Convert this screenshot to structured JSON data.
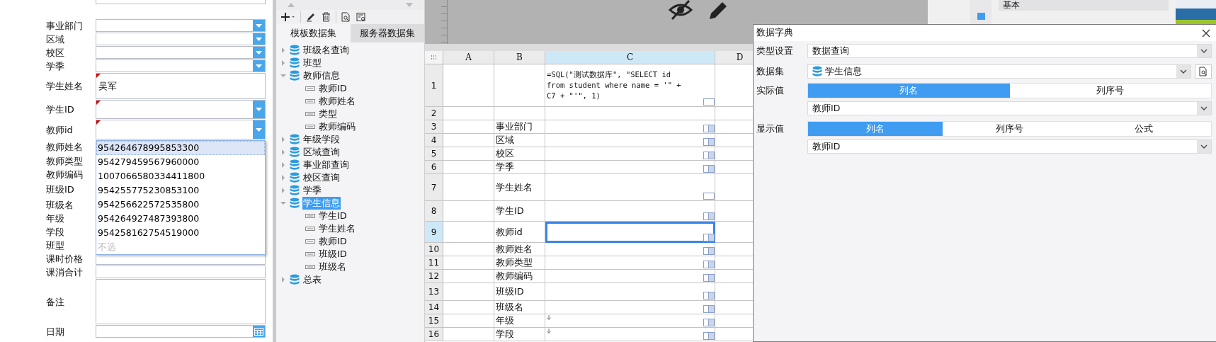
{
  "form": {
    "fields": [
      {
        "label": "事业部门",
        "kind": "combo",
        "flagged": false
      },
      {
        "label": "区域",
        "kind": "combo",
        "flagged": false
      },
      {
        "label": "校区",
        "kind": "combo",
        "flagged": false
      },
      {
        "label": "学季",
        "kind": "combo",
        "flagged": false
      },
      {
        "label": "学生姓名",
        "kind": "text",
        "value": "吴军",
        "flagged": true
      },
      {
        "label": "学生ID",
        "kind": "combo",
        "flagged": true
      },
      {
        "label": "教师id",
        "kind": "combo",
        "flagged": true
      },
      {
        "label": "教师姓名",
        "kind": "covered"
      },
      {
        "label": "教师类型",
        "kind": "covered"
      },
      {
        "label": "教师编码",
        "kind": "covered"
      },
      {
        "label": "班级ID",
        "kind": "covered"
      },
      {
        "label": "班级名",
        "kind": "covered"
      },
      {
        "label": "年级",
        "kind": "covered"
      },
      {
        "label": "学段",
        "kind": "covered"
      },
      {
        "label": "班型",
        "kind": "covered"
      },
      {
        "label": "课时价格",
        "kind": "text",
        "flagged": false
      },
      {
        "label": "课消合计",
        "kind": "text",
        "flagged": false
      },
      {
        "label": "备注",
        "kind": "textarea",
        "flagged": false
      },
      {
        "label": "日期",
        "kind": "date",
        "flagged": false
      }
    ],
    "dropdown": {
      "options": [
        {
          "text": "954264678995853300",
          "selected": true,
          "disabled": false
        },
        {
          "text": "954279459567960000",
          "selected": false,
          "disabled": false
        },
        {
          "text": "1007066580334411800",
          "selected": false,
          "disabled": false
        },
        {
          "text": "954255775230853100",
          "selected": false,
          "disabled": false
        },
        {
          "text": "954256622572535800",
          "selected": false,
          "disabled": false
        },
        {
          "text": "954264927487393800",
          "selected": false,
          "disabled": false
        },
        {
          "text": "954258162754519000",
          "selected": false,
          "disabled": false
        },
        {
          "text": "不选",
          "selected": false,
          "disabled": true
        }
      ]
    }
  },
  "dataset_panel": {
    "tabs": [
      {
        "label": "模板数据集",
        "selected": true
      },
      {
        "label": "服务器数据集",
        "selected": false
      }
    ],
    "tree": [
      {
        "label": "班级名查询",
        "kind": "dataset",
        "expanded": false,
        "selected": false
      },
      {
        "label": "班型",
        "kind": "dataset",
        "expanded": false,
        "selected": false
      },
      {
        "label": "教师信息",
        "kind": "dataset",
        "expanded": true,
        "selected": false,
        "children": [
          {
            "label": "教师ID",
            "kind": "field",
            "selected": false
          },
          {
            "label": "教师姓名",
            "kind": "field",
            "selected": false
          },
          {
            "label": "类型",
            "kind": "field",
            "selected": false
          },
          {
            "label": "教师编码",
            "kind": "field",
            "selected": false
          }
        ]
      },
      {
        "label": "年级学段",
        "kind": "dataset",
        "expanded": false,
        "selected": false
      },
      {
        "label": "区域查询",
        "kind": "dataset",
        "expanded": false,
        "selected": false
      },
      {
        "label": "事业部查询",
        "kind": "dataset",
        "expanded": false,
        "selected": false
      },
      {
        "label": "校区查询",
        "kind": "dataset",
        "expanded": false,
        "selected": false
      },
      {
        "label": "学季",
        "kind": "dataset",
        "expanded": false,
        "selected": false
      },
      {
        "label": "学生信息",
        "kind": "dataset",
        "expanded": true,
        "selected": true,
        "children": [
          {
            "label": "学生ID",
            "kind": "field",
            "selected": false
          },
          {
            "label": "学生姓名",
            "kind": "field",
            "selected": false
          },
          {
            "label": "教师ID",
            "kind": "field",
            "selected": false
          },
          {
            "label": "班级ID",
            "kind": "field",
            "selected": false
          },
          {
            "label": "班级名",
            "kind": "field",
            "selected": false
          }
        ]
      },
      {
        "label": "总表",
        "kind": "dataset",
        "expanded": false,
        "selected": false
      }
    ]
  },
  "property_panel": {
    "section": "基本"
  },
  "sheet": {
    "columns": [
      {
        "label": "A",
        "selected": false
      },
      {
        "label": "B",
        "selected": false
      },
      {
        "label": "C",
        "selected": true
      },
      {
        "label": "D",
        "selected": false
      }
    ],
    "rows": [
      {
        "number": "1",
        "selected": false,
        "c": "=SQL(\"测试数据库\", \"SELECT id from student where name = '\" + C7 + \"'\", 1)",
        "kind": "text",
        "expand": false
      },
      {
        "number": "2",
        "selected": false,
        "expand": false
      },
      {
        "number": "3",
        "selected": false,
        "b": "事业部门",
        "kind": "combo",
        "expand": false
      },
      {
        "number": "4",
        "selected": false,
        "b": "区域",
        "kind": "combo",
        "expand": false
      },
      {
        "number": "5",
        "selected": false,
        "b": "校区",
        "kind": "combo",
        "expand": false
      },
      {
        "number": "6",
        "selected": false,
        "b": "学季",
        "kind": "combo",
        "expand": false
      },
      {
        "number": "7",
        "selected": false,
        "b": "学生姓名",
        "kind": "text",
        "expand": false
      },
      {
        "number": "8",
        "selected": false,
        "b": "学生ID",
        "kind": "combo",
        "expand": false
      },
      {
        "number": "9",
        "selected": true,
        "b": "教师id",
        "kind": "combo",
        "expand": false
      },
      {
        "number": "10",
        "selected": false,
        "b": "教师姓名",
        "kind": "combo",
        "expand": false
      },
      {
        "number": "11",
        "selected": false,
        "b": "教师类型",
        "kind": "combo",
        "expand": false
      },
      {
        "number": "12",
        "selected": false,
        "b": "教师编码",
        "kind": "combo",
        "expand": false
      },
      {
        "number": "13",
        "selected": false,
        "b": "班级ID",
        "kind": "combo",
        "expand": false
      },
      {
        "number": "14",
        "selected": false,
        "b": "班级名",
        "kind": "combo",
        "expand": false
      },
      {
        "number": "15",
        "selected": false,
        "b": "年级",
        "kind": "combo",
        "expand": true
      },
      {
        "number": "16",
        "selected": false,
        "b": "学段",
        "kind": "combo",
        "expand": true
      }
    ]
  },
  "dialog": {
    "title": "数据字典",
    "type_setting": {
      "label": "类型设置",
      "value": "数据查询"
    },
    "dataset": {
      "label": "数据集",
      "value": "学生信息"
    },
    "actual_value": {
      "label": "实际值",
      "modes": [
        {
          "label": "列名",
          "selected": true
        },
        {
          "label": "列序号",
          "selected": false
        }
      ],
      "value": "教师ID"
    },
    "display_value": {
      "label": "显示值",
      "modes": [
        {
          "label": "列名",
          "selected": true
        },
        {
          "label": "列序号",
          "selected": false
        },
        {
          "label": "公式",
          "selected": false
        }
      ],
      "value": "教师ID"
    }
  }
}
